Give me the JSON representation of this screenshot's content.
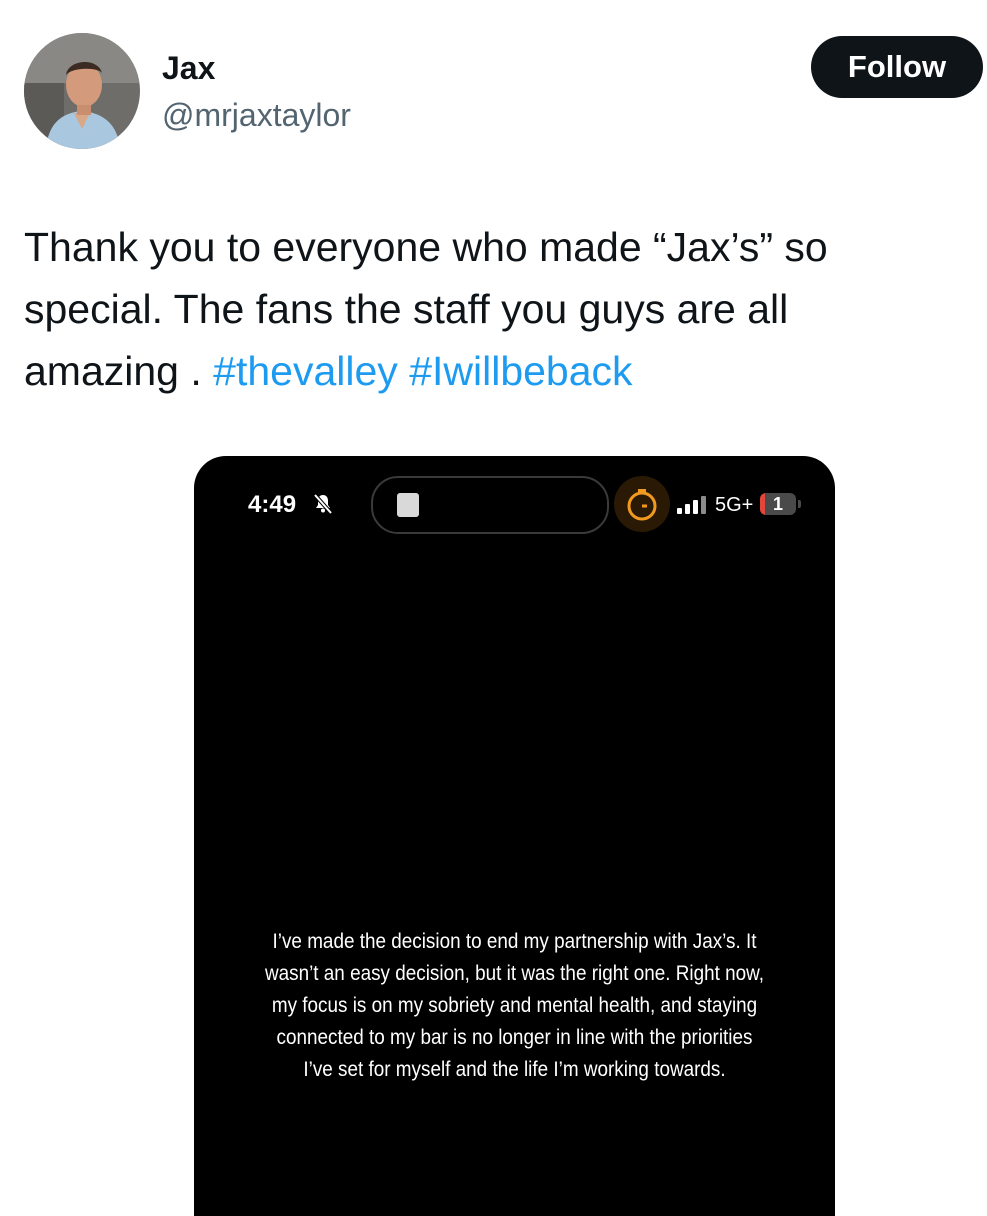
{
  "author": {
    "display_name": "Jax",
    "handle": "@mrjaxtaylor"
  },
  "follow_button": {
    "label": "Follow"
  },
  "tweet": {
    "text_plain": "Thank you to everyone who made “Jax’s” so special. The fans the staff you guys are all amazing . ",
    "hashtags": [
      "#thevalley",
      "#Iwillbeback"
    ],
    "hashtag_separator": " "
  },
  "media": {
    "status_bar": {
      "time": "4:49",
      "network": "5G+",
      "battery": "1",
      "battery_level": 0.01
    },
    "story_text": "I’ve made the decision to end my partnership with Jax’s. It wasn’t an easy decision, but it was the right one. Right now, my focus is on my sobriety and mental health, and staying connected to my bar is no longer in line with the priorities I’ve set for myself and the life I’m working towards."
  },
  "colors": {
    "text_primary": "#0f1419",
    "text_secondary": "#536471",
    "hashtag": "#1d9bf0",
    "follow_bg": "#0f1419",
    "timer_accent": "#f29a1f"
  },
  "icons": {
    "bell": "bell-slash-icon",
    "timer": "stopwatch-icon",
    "signal": "cellular-signal-icon",
    "battery": "battery-icon"
  }
}
